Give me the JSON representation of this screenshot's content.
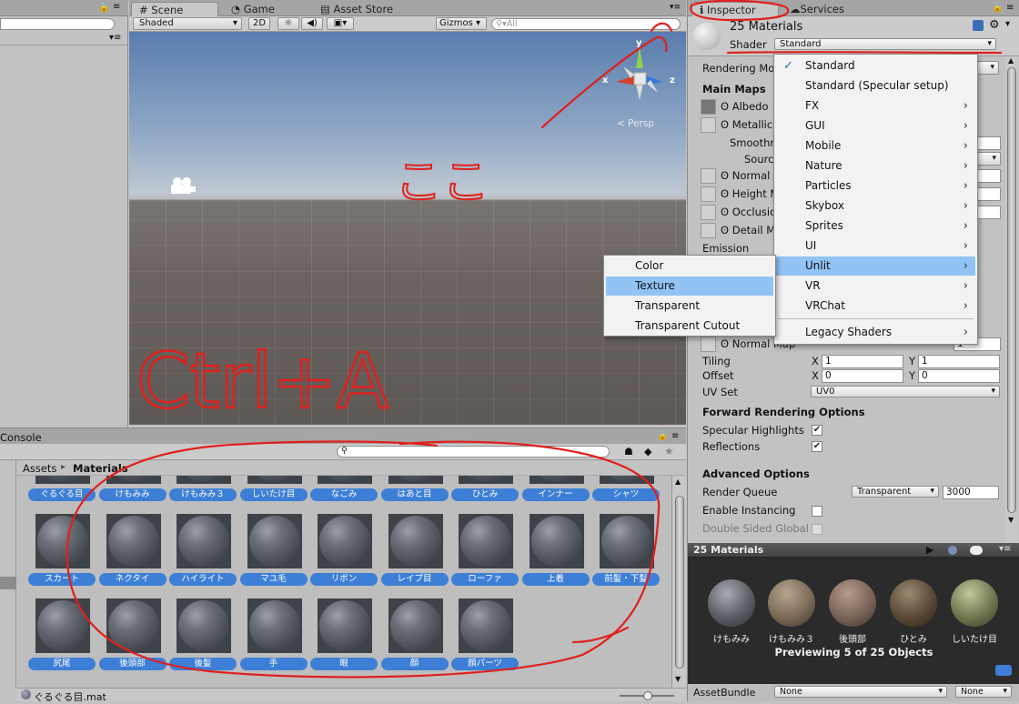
{
  "scene": {
    "tabs": [
      "Scene",
      "Game",
      "Asset Store"
    ],
    "shading_mode": "Shaded",
    "btn_2d": "2D",
    "gizmos": "Gizmos",
    "search_placeholder": "All",
    "persp": "Persp",
    "axes": {
      "y": "y",
      "x": "x",
      "z": "z"
    }
  },
  "console": {
    "tab": "Console"
  },
  "project": {
    "breadcrumb_root": "Assets",
    "breadcrumb_sep": "▸",
    "breadcrumb_current": "Materials",
    "top_row": [
      "ぐるぐる目",
      "けもみみ",
      "けもみみ３",
      "しいたけ目",
      "なごみ",
      "はあと目",
      "ひとみ",
      "インナー",
      "シャツ"
    ],
    "row2": [
      "スカート",
      "ネクタイ",
      "ハイライト",
      "マユ毛",
      "リボン",
      "レイプ目",
      "ローファ",
      "上着",
      "前髪・下髪"
    ],
    "row3": [
      "尻尾",
      "後頭部",
      "後髪",
      "手",
      "眼",
      "顔",
      "顔パーツ"
    ],
    "status_file": "ぐるぐる目.mat"
  },
  "inspector": {
    "tabs": [
      "Inspector",
      "Services"
    ],
    "title": "25 Materials",
    "shader_label": "Shader",
    "shader_value": "Standard",
    "rendering_mode": "Rendering Mo",
    "main_maps": "Main Maps",
    "albedo": "Albedo",
    "metallic": "Metallic",
    "smoothness": "Smoothn",
    "source": "Sourc",
    "normal_map": "Normal M",
    "height_map": "Height M",
    "occlusion": "Occlusio",
    "detail_mask": "Detail Ma",
    "emission": "Emission",
    "normal_map2": "Normal Map",
    "normal_val": "1",
    "tiling": "Tiling",
    "offset": "Offset",
    "tiling_x": "1",
    "tiling_y": "1",
    "offset_x": "0",
    "offset_y": "0",
    "x": "X",
    "y": "Y",
    "uv_set": "UV Set",
    "uv_value": "UV0",
    "forward_rendering": "Forward Rendering Options",
    "specular_highlights": "Specular Highlights",
    "reflections": "Reflections",
    "advanced_options": "Advanced Options",
    "render_queue": "Render Queue",
    "render_queue_mode": "Transparent",
    "render_queue_value": "3000",
    "enable_instancing": "Enable Instancing",
    "double_sided": "Double Sided Global"
  },
  "shader_menu": {
    "items": [
      "Standard",
      "Standard (Specular setup)",
      "FX",
      "GUI",
      "Mobile",
      "Nature",
      "Particles",
      "Skybox",
      "Sprites",
      "UI",
      "Unlit",
      "VR",
      "VRChat",
      "Legacy Shaders"
    ],
    "checked": "Standard",
    "highlighted": "Unlit"
  },
  "unlit_menu": {
    "items": [
      "Color",
      "Texture",
      "Transparent",
      "Transparent Cutout"
    ],
    "highlighted": "Texture"
  },
  "preview": {
    "title": "25 Materials",
    "labels": [
      "けもみみ",
      "けもみみ３",
      "後頭部",
      "ひとみ",
      "しいたけ目"
    ],
    "caption": "Previewing 5 of 25 Objects",
    "assetbundle_label": "AssetBundle",
    "assetbundle_value": "None",
    "assetbundle_variant": "None"
  },
  "annotations": {
    "koko": "ここ",
    "ctrl_a": "Ctrl+A"
  },
  "colors": {
    "annotation": "#e0201c",
    "highlight": "#92c3f5",
    "pill": "#3d7fd6"
  }
}
